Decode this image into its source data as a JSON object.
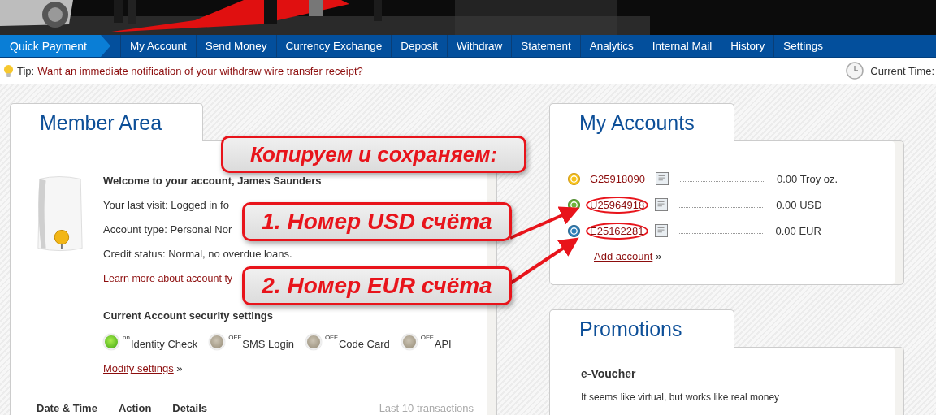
{
  "nav": {
    "quick_payment": "Quick Payment",
    "items": [
      {
        "label": "My Account"
      },
      {
        "label": "Send Money"
      },
      {
        "label": "Currency Exchange"
      },
      {
        "label": "Deposit"
      },
      {
        "label": "Withdraw"
      },
      {
        "label": "Statement"
      },
      {
        "label": "Analytics"
      },
      {
        "label": "Internal Mail"
      },
      {
        "label": "History"
      },
      {
        "label": "Settings"
      }
    ]
  },
  "tip_bar": {
    "label": "Tip:",
    "link": "Want an immediate notification of your withdraw wire transfer receipt?",
    "current_time": "Current Time:"
  },
  "member_area": {
    "title": "Member Area",
    "welcome": "Welcome to your account, James Saunders",
    "lines": [
      "Your last visit: Logged in fo",
      "Account type: Personal Nor",
      "Credit status: Normal, no overdue loans."
    ],
    "learn_more": "Learn more about account ty",
    "security": {
      "title": "Current Account security settings",
      "items": [
        {
          "state_label": "on",
          "label": "Identity Check",
          "on": true
        },
        {
          "state_label": "OFF",
          "label": "SMS Login",
          "on": false
        },
        {
          "state_label": "OFF",
          "label": "Code Card",
          "on": false
        },
        {
          "state_label": "OFF",
          "label": "API",
          "on": false
        }
      ],
      "modify": "Modify settings",
      "modify_suffix": "»"
    },
    "table_header": {
      "columns": [
        "Date & Time",
        "Action",
        "Details"
      ],
      "note": "Last 10 transactions"
    }
  },
  "my_accounts": {
    "title": "My Accounts",
    "accounts": [
      {
        "kind": "gold",
        "number": "G25918090",
        "balance": "0.00 Troy oz.",
        "circled": false
      },
      {
        "kind": "usd",
        "number": "U25964918",
        "balance": "0.00 USD",
        "circled": true
      },
      {
        "kind": "eur",
        "number": "E25162281",
        "balance": "0.00 EUR",
        "circled": true
      }
    ],
    "add_account": "Add account",
    "add_suffix": "»"
  },
  "promotions": {
    "title": "Promotions",
    "heading": "e-Voucher",
    "text": "It seems like virtual, but works like real money"
  },
  "annotations": [
    {
      "kind": "heading",
      "text": "Копируем и сохраняем:"
    },
    {
      "kind": "pointer",
      "text": "1. Номер USD счёта"
    },
    {
      "kind": "pointer",
      "text": "2. Номер EUR счёта"
    }
  ]
}
